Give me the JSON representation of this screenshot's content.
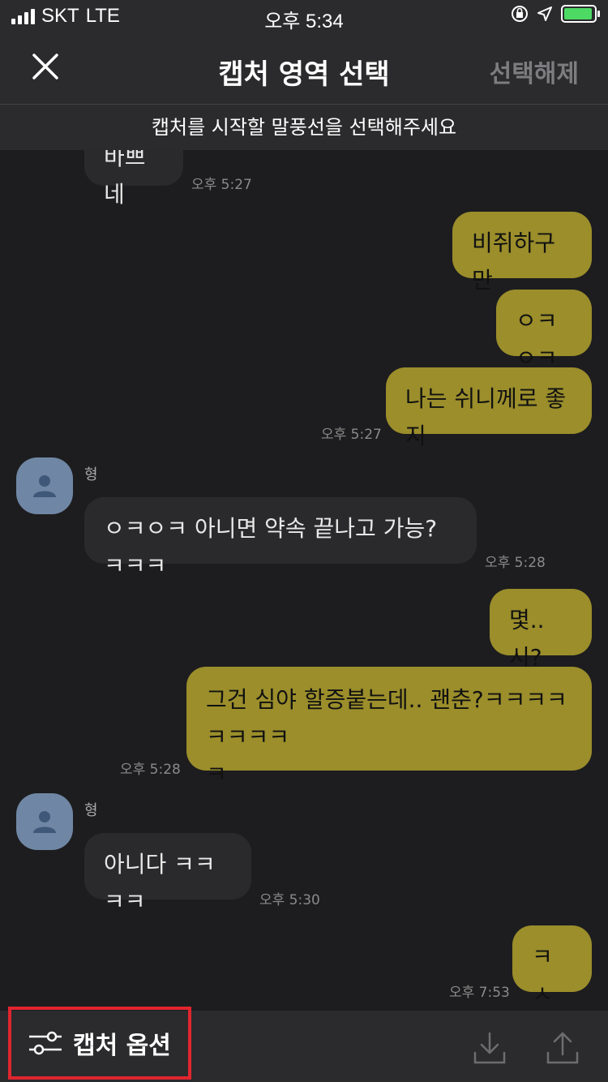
{
  "status_bar": {
    "carrier": "SKT",
    "network": "LTE",
    "time": "오후 5:34"
  },
  "header": {
    "title": "캡처 영역 선택",
    "deselect_label": "선택해제",
    "close_icon": "close-icon"
  },
  "subbar": {
    "instruction": "캡처를 시작할 말풍선을 선택해주세요"
  },
  "messages": [
    {
      "from": "other",
      "text": "바쁘네",
      "time": "오후 5:27"
    },
    {
      "from": "me",
      "text": "비쥐하구만"
    },
    {
      "from": "me",
      "text": "ㅇㅋㅇㅋ"
    },
    {
      "from": "me",
      "text": "나는 쉬니께로 좋지",
      "time": "오후 5:27"
    },
    {
      "from": "other",
      "sender": "형",
      "text": "ㅇㅋㅇㅋ 아니면 약속 끝나고 가능? ㅋㅋㅋ",
      "time": "오후 5:28"
    },
    {
      "from": "me",
      "text": "몇..시?"
    },
    {
      "from": "me",
      "text_line1": "그건 심야 할증붙는데.. 괜춘?ㅋㅋㅋㅋㅋㅋㅋㅋ",
      "text_line2": "ㅋ",
      "time": "오후 5:28"
    },
    {
      "from": "other",
      "sender": "형",
      "text": "아니다 ㅋㅋㅋㅋ",
      "time": "오후 5:30"
    },
    {
      "from": "me",
      "text": "ㅋㅅㅋ",
      "time": "오후 7:53"
    }
  ],
  "toolbar": {
    "capture_option_label": "캡처 옵션",
    "download_icon": "download-icon",
    "share_icon": "share-icon"
  },
  "colors": {
    "background": "#1d1d1f",
    "my_bubble": "#9b8e2b",
    "other_bubble": "#2a2a2c",
    "highlight": "#e0252f",
    "battery": "#4cd964"
  }
}
